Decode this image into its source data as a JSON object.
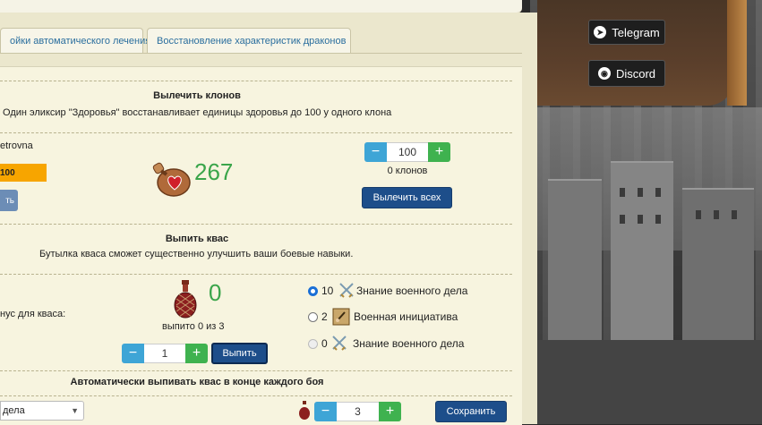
{
  "social": {
    "telegram_label": "Telegram",
    "discord_label": "Discord"
  },
  "tabs": [
    {
      "label": "ойки автоматического лечения"
    },
    {
      "label": "Восстановление характеристик драконов"
    }
  ],
  "heal": {
    "title": "Вылечить клонов",
    "description": "Один эликсир \"Здоровья\" восстанавливает единицы здоровья до 100 у одного клона",
    "clone_name": "etrovna",
    "health_value": "100",
    "small_button": "ть",
    "elixir_count": "267",
    "stepper_value": "100",
    "clones_count_text": "0 клонов",
    "heal_all_button": "Вылечить всех"
  },
  "kvass": {
    "title": "Выпить квас",
    "description": "Бутылка кваса сможет существенно улучшить ваши боевые навыки.",
    "bonus_label": "нус для кваса:",
    "count": "0",
    "drunk_text": "выпито 0 из 3",
    "stepper_value": "1",
    "drink_button": "Выпить",
    "options": [
      {
        "value": "10",
        "label": "Знание военного дела",
        "state": "checked",
        "icon": "crossed-swords-icon"
      },
      {
        "value": "2",
        "label": "Военная инициатива",
        "state": "unchecked",
        "icon": "scroll-hand-icon"
      },
      {
        "value": "0",
        "label": "Знание военного дела",
        "state": "disabled",
        "icon": "crossed-swords-icon"
      }
    ]
  },
  "auto": {
    "title": "Автоматически выпивать квас в конце каждого боя",
    "select_value": "дела",
    "stepper_value": "3",
    "save_button": "Сохранить"
  },
  "colors": {
    "accent_blue": "#1d4e8a",
    "count_green": "#3aa54a",
    "health_orange": "#f7a500"
  }
}
